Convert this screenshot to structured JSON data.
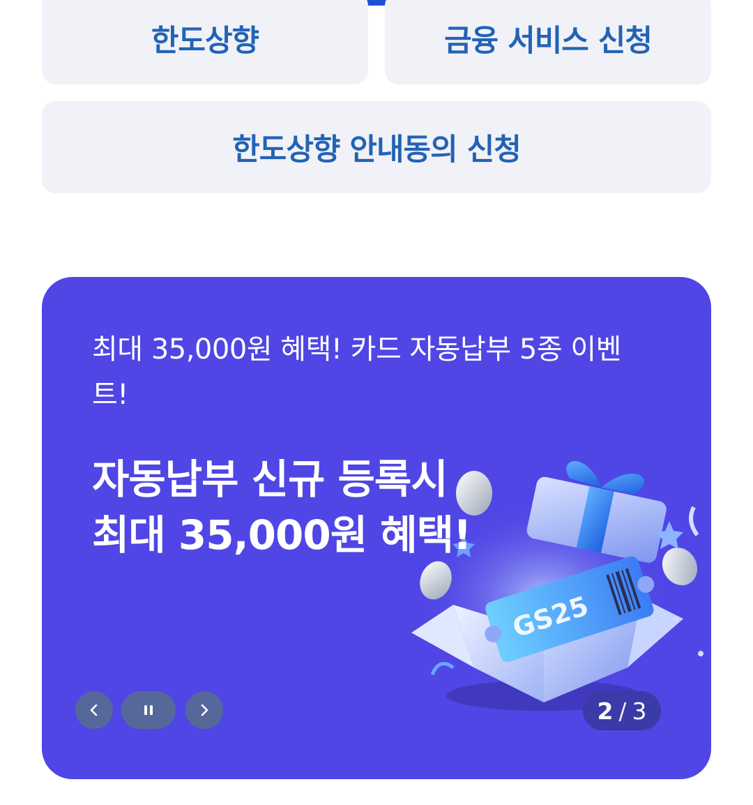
{
  "buttons": {
    "limit_increase": "한도상향",
    "finance_service": "금융 서비스 신청",
    "limit_notice_consent": "한도상향 안내동의 신청"
  },
  "banner": {
    "subtitle": "최대 35,000원 혜택! 카드 자동납부 5종 이벤트!",
    "title_line1": "자동납부 신규 등록시",
    "title_line2": "최대 35,000원 혜택!",
    "ticket_text": "GS25",
    "background_color": "#4f46e5",
    "controls": {
      "prev_icon": "chevron-left-icon",
      "pause_icon": "pause-icon",
      "next_icon": "chevron-right-icon"
    },
    "pagination": {
      "current": "2",
      "separator": "/",
      "total": "3"
    }
  },
  "colors": {
    "button_text": "#2363b5",
    "button_bg": "#f0f2f7",
    "tab_indicator": "#1f4fd1"
  }
}
